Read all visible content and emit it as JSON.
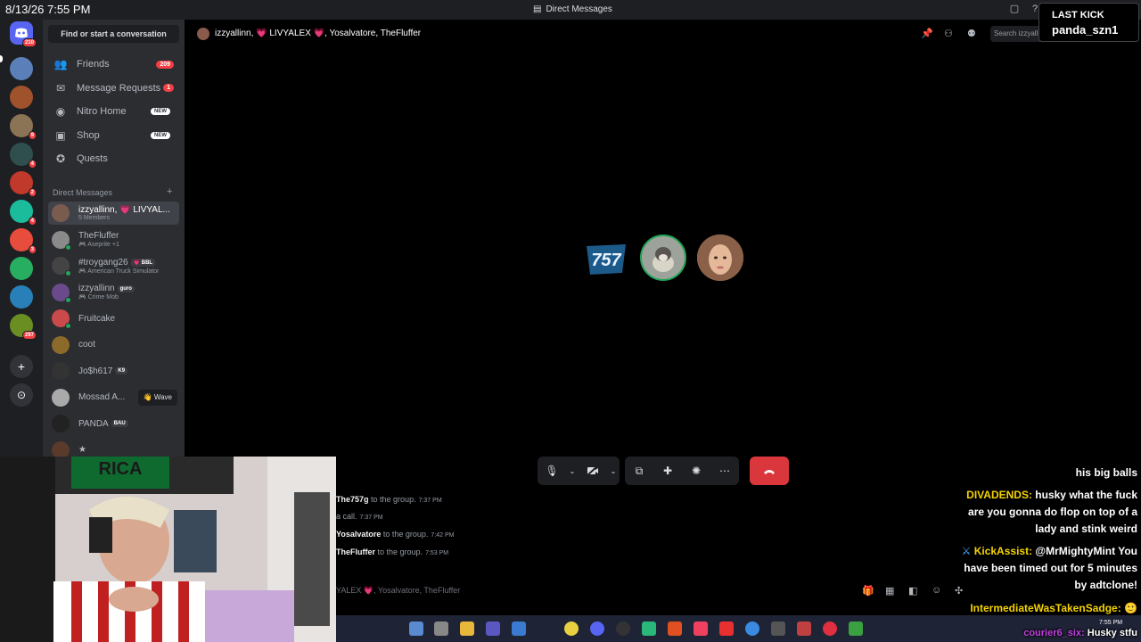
{
  "titlebar": {
    "datetime": "8/13/26 7:55 PM",
    "title": "Direct Messages"
  },
  "rail": {
    "home_badge": "210",
    "servers": [
      {
        "badge": "",
        "color": "#5b7fb8"
      },
      {
        "badge": "",
        "color": "#a0522d"
      },
      {
        "badge": "9",
        "color": "#8b7355"
      },
      {
        "badge": "4",
        "color": "#2f4f4f"
      },
      {
        "badge": "2",
        "color": "#c0392b"
      },
      {
        "badge": "4",
        "color": "#1abc9c"
      },
      {
        "badge": "3",
        "color": "#e74c3c"
      },
      {
        "badge": "",
        "color": "#27ae60"
      },
      {
        "badge": "",
        "color": "#2980b9"
      },
      {
        "badge": "297",
        "color": "#6b8e23"
      }
    ]
  },
  "sidebar": {
    "find_label": "Find or start a conversation",
    "nav": [
      {
        "label": "Friends",
        "icon": "friends-icon",
        "glyph": "👥",
        "badge": "209",
        "badge_type": "red"
      },
      {
        "label": "Message Requests",
        "icon": "mail-icon",
        "glyph": "✉",
        "badge": "1",
        "badge_type": "red"
      },
      {
        "label": "Nitro Home",
        "icon": "nitro-icon",
        "glyph": "◉",
        "badge": "NEW",
        "badge_type": "new"
      },
      {
        "label": "Shop",
        "icon": "shop-icon",
        "glyph": "▣",
        "badge": "NEW",
        "badge_type": "new"
      },
      {
        "label": "Quests",
        "icon": "quests-icon",
        "glyph": "✪",
        "badge": "",
        "badge_type": ""
      }
    ],
    "dm_header": "Direct Messages",
    "dms": [
      {
        "name": "izzyallinn, 💗 LIVYAL...",
        "sub": "5 Members",
        "tag": "",
        "color": "#7a5c4f",
        "active": true,
        "status": false
      },
      {
        "name": "TheFluffer",
        "sub": "🎮 Aseprite +1",
        "tag": "",
        "color": "#8a8a8a",
        "active": false,
        "status": true
      },
      {
        "name": "#troygang26",
        "sub": "🎮 American Truck Simulator",
        "tag": "💗 BBL",
        "color": "#444",
        "active": false,
        "status": true
      },
      {
        "name": "izzyallinn",
        "sub": "🎮 Crime Mob",
        "tag": "guro",
        "color": "#6a4a8a",
        "active": false,
        "status": true
      },
      {
        "name": "Fruitcake",
        "sub": "",
        "tag": "",
        "color": "#c94a4a",
        "active": false,
        "status": true
      },
      {
        "name": "coot",
        "sub": "",
        "tag": "",
        "color": "#8b6a2a",
        "active": false,
        "status": false
      },
      {
        "name": "Jo$h617",
        "sub": "",
        "tag": "K9",
        "color": "#333",
        "active": false,
        "status": false
      },
      {
        "name": "Mossad A...",
        "sub": "",
        "tag": "",
        "color": "#aaa",
        "active": false,
        "status": false,
        "wave": "👋 Wave"
      },
      {
        "name": "PANDA",
        "sub": "",
        "tag": "BAU",
        "color": "#222",
        "active": false,
        "status": false
      },
      {
        "name": "★",
        "sub": "",
        "tag": "",
        "color": "#5a3a2a",
        "active": false,
        "status": false
      }
    ]
  },
  "call": {
    "names": "izzyallinn, 💗 LIVYALEX 💗, Yosalvatore, TheFluffer",
    "search_placeholder": "Search izzyallinn...",
    "tiles": [
      {
        "label": "757",
        "color": "#1a3a5a"
      },
      {
        "label": "",
        "color": "#8a8f88"
      },
      {
        "label": "",
        "color": "#c9a488"
      }
    ]
  },
  "chat": {
    "messages": [
      {
        "name": "The757g",
        "text": "to the group.",
        "time": "7:37 PM"
      },
      {
        "name": "",
        "text": "a call.",
        "time": "7:37 PM"
      },
      {
        "name": "Yosalvatore",
        "text": "to the group.",
        "time": "7:42 PM"
      },
      {
        "name": "TheFluffer",
        "text": "to the group.",
        "time": "7:53 PM"
      }
    ],
    "input_placeholder": "YALEX 💗, Yosalvatore, TheFluffer"
  },
  "overlay": {
    "line1": "his big balls",
    "divadends_user": "DIVADENDS:",
    "divadends_msg1": "husky what the fuck",
    "divadends_msg2": "are you gonna do flop on top of a",
    "divadends_msg3": "lady and stink weird",
    "kickassist_user": "KickAssist:",
    "kickassist_msg1": "@MrMightyMint You",
    "kickassist_msg2": "have been timed out for 5 minutes",
    "kickassist_msg3": "by adtclone!",
    "intermediate_user": "IntermediateWasTakenSadge:",
    "courier_user": "courier6_six:",
    "courier_msg": "Husky stfu"
  },
  "lastkick": {
    "title": "LAST KICK",
    "name": "panda_szn1"
  },
  "taskbar": {
    "time": "7:55 PM"
  }
}
